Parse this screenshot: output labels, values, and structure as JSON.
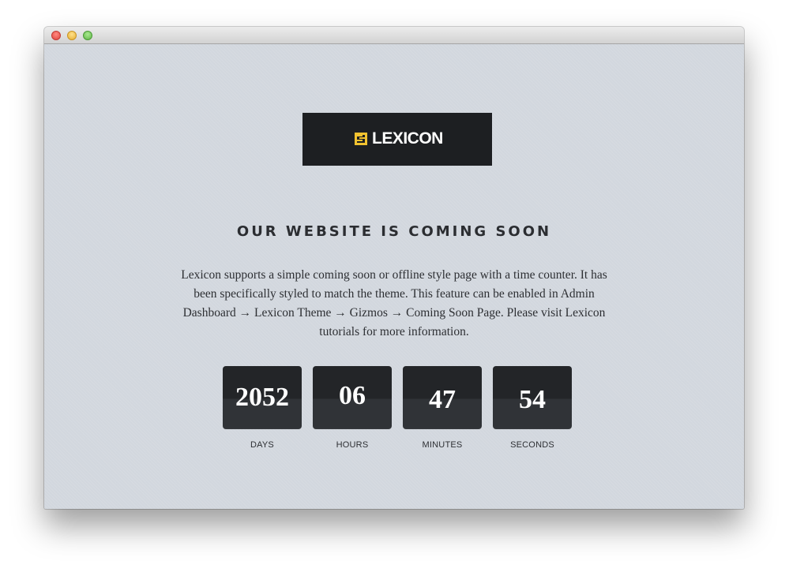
{
  "window": {
    "controls": {
      "close": "close-button",
      "minimize": "minimize-button",
      "zoom": "zoom-button"
    }
  },
  "logo": {
    "text": "LEXICON",
    "icon": "lexicon-logo-icon",
    "accent_color": "#f2c230",
    "box_color": "#1d1f22"
  },
  "headline": "OUR WEBSITE IS COMING SOON",
  "description": "Lexicon supports a simple coming soon or offline style page with a time counter. It has been specifically styled to match the theme. This feature can be enabled in Admin Dashboard → Lexicon Theme → Gizmos → Coming Soon Page. Please visit Lexicon tutorials for more information.",
  "countdown": [
    {
      "value": "2052",
      "label": "DAYS"
    },
    {
      "value": "06",
      "label": "HOURS"
    },
    {
      "value": "47",
      "label": "MINUTES"
    },
    {
      "value": "54",
      "label": "SECONDS"
    }
  ]
}
